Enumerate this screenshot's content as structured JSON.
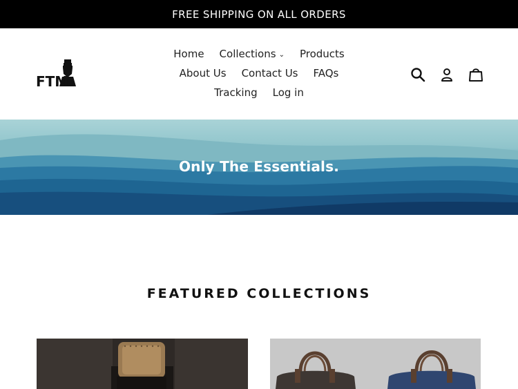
{
  "announcement": {
    "text": "FREE SHIPPING ON ALL ORDERS"
  },
  "logo": {
    "text": "FTM"
  },
  "nav": {
    "row1": [
      "Home",
      "Collections",
      "Products"
    ],
    "row2": [
      "About Us",
      "Contact Us",
      "FAQs"
    ],
    "row3": [
      "Tracking",
      "Log in"
    ]
  },
  "icons": {
    "search": "search-icon",
    "account": "account-icon",
    "cart": "cart-icon",
    "collections_dropdown": "chevron-down-icon"
  },
  "hero": {
    "title": "Only The Essentials."
  },
  "featured": {
    "title": "FEATURED COLLECTIONS"
  },
  "colors": {
    "announcement_bg": "#000000",
    "hero_dark": "#123f6e",
    "hero_light": "#a9d3d7"
  }
}
